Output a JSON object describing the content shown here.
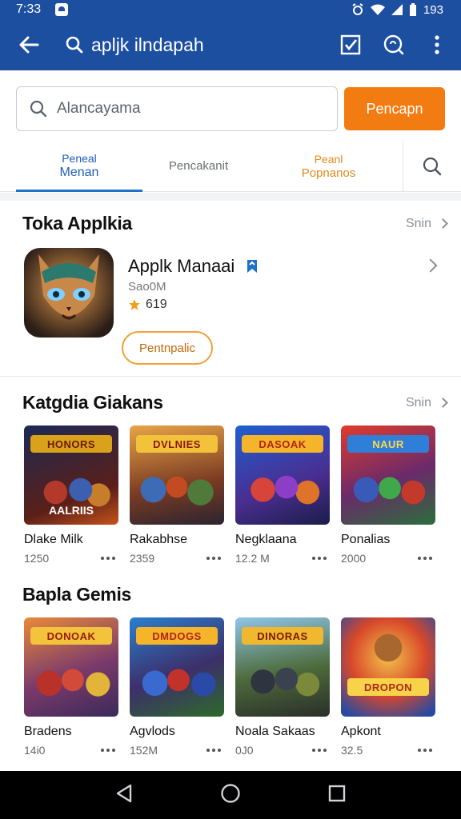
{
  "status": {
    "time": "7:33",
    "battery": "193"
  },
  "appbar": {
    "title": "apljk ilndapah"
  },
  "search": {
    "placeholder": "Alancayama",
    "button": "Pencapn"
  },
  "tabs": [
    {
      "line1": "Peneal",
      "line2": "Menan"
    },
    {
      "line1": "Pencakanit",
      "line2": ""
    },
    {
      "line1": "Peanl",
      "line2": "Popnanos"
    }
  ],
  "top_apps": {
    "title": "Toka Applkia",
    "more": "Snin",
    "featured": {
      "name": "Applk Manaai",
      "size": "Sao0M",
      "rating": "619",
      "button": "Pentnpalic"
    }
  },
  "category": {
    "title": "Katgdia Giakans",
    "more": "Snin",
    "items": [
      {
        "name": "Dlake Milk",
        "meta": "1250",
        "banner": "HONORS",
        "caption": "AALRIIS"
      },
      {
        "name": "Rakabhse",
        "meta": "2359",
        "banner": "DVLNIES",
        "caption": ""
      },
      {
        "name": "Negklaana",
        "meta": "12.2 M",
        "banner": "DASOAK",
        "caption": ""
      },
      {
        "name": "Ponalias",
        "meta": "2000",
        "banner": "NAUR",
        "caption": ""
      }
    ]
  },
  "popular": {
    "title": "Bapla Gemis",
    "items": [
      {
        "name": "Bradens",
        "meta": "14i0",
        "banner": "DONOAK",
        "caption": ""
      },
      {
        "name": "Agvlods",
        "meta": "152M",
        "banner": "DMDOGS",
        "caption": ""
      },
      {
        "name": "Noala Sakaas",
        "meta": "0J0",
        "banner": "DINORAS",
        "caption": ""
      },
      {
        "name": "Apkont",
        "meta": "32.5",
        "banner": "DROPON",
        "caption": ""
      }
    ]
  },
  "colors": {
    "primary": "#1d4fa0",
    "accent": "#f37c12",
    "tab_active": "#1e5fb4"
  }
}
